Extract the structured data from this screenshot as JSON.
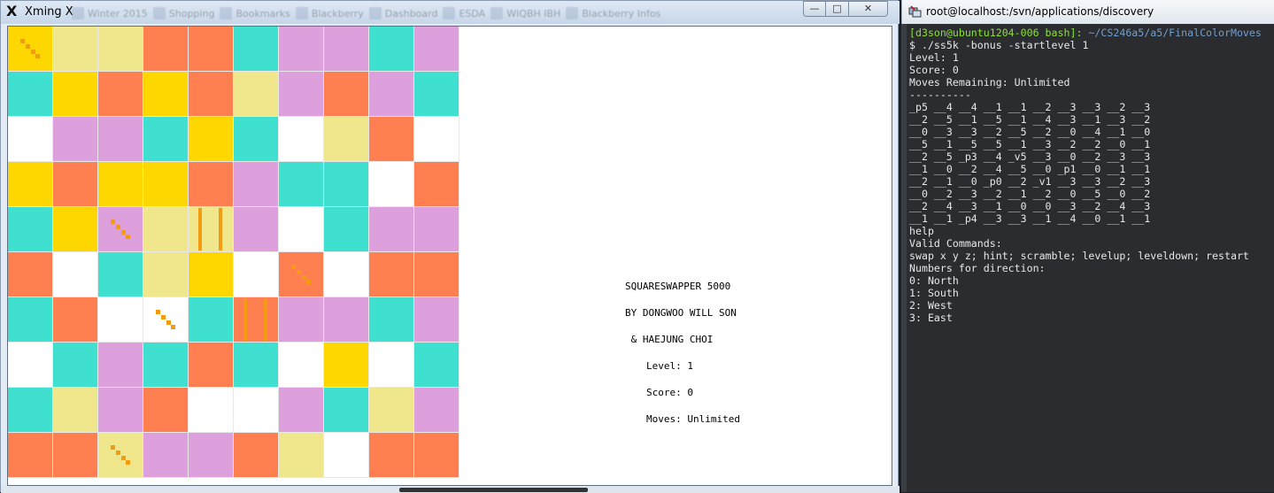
{
  "xming": {
    "title": "Xming X",
    "background_tabs": [
      "Winter 2015",
      "Shopping",
      "Bookmarks",
      "Blackberry",
      "Dashboard",
      "ESDA",
      "WIQBH IBH",
      "Blackberry Infos"
    ],
    "min_label": "—",
    "max_label": "□",
    "close_label": "✕",
    "board": {
      "colors": {
        "Y": "#FFD700",
        "K": "#F0E68C",
        "O": "#FF7F50",
        "T": "#40E0D0",
        "P": "#DDA0DD",
        "W": "#FFFFFF"
      },
      "rows": [
        [
          "Y",
          "K",
          "K",
          "O",
          "O",
          "T",
          "P",
          "P",
          "T",
          "P"
        ],
        [
          "T",
          "Y",
          "O",
          "Y",
          "O",
          "K",
          "P",
          "O",
          "P",
          "T"
        ],
        [
          "W",
          "P",
          "P",
          "T",
          "Y",
          "T",
          "W",
          "K",
          "O",
          "W"
        ],
        [
          "Y",
          "O",
          "Y",
          "Y",
          "O",
          "P",
          "T",
          "T",
          "W",
          "O"
        ],
        [
          "T",
          "Y",
          "P",
          "K",
          "K",
          "P",
          "W",
          "T",
          "P",
          "P"
        ],
        [
          "O",
          "W",
          "T",
          "K",
          "Y",
          "W",
          "O",
          "W",
          "O",
          "O"
        ],
        [
          "T",
          "O",
          "W",
          "W",
          "T",
          "O",
          "P",
          "P",
          "T",
          "P"
        ],
        [
          "W",
          "T",
          "P",
          "T",
          "O",
          "T",
          "W",
          "Y",
          "W",
          "T"
        ],
        [
          "T",
          "K",
          "P",
          "O",
          "W",
          "W",
          "P",
          "T",
          "K",
          "P"
        ],
        [
          "O",
          "O",
          "K",
          "P",
          "P",
          "O",
          "K",
          "W",
          "O",
          "O"
        ]
      ],
      "marks": [
        {
          "row": 0,
          "col": 0,
          "kind": "diag"
        },
        {
          "row": 4,
          "col": 2,
          "kind": "diag"
        },
        {
          "row": 4,
          "col": 4,
          "kind": "bars"
        },
        {
          "row": 5,
          "col": 6,
          "kind": "diag"
        },
        {
          "row": 6,
          "col": 3,
          "kind": "diag"
        },
        {
          "row": 6,
          "col": 5,
          "kind": "bars"
        },
        {
          "row": 9,
          "col": 2,
          "kind": "diag"
        }
      ]
    },
    "info": {
      "title": "SQUARESWAPPER 5000",
      "byline": "BY DONGWOO WILL SON",
      "coauthor": " & HAEJUNG CHOI",
      "level": "Level: 1",
      "score": "Score: 0",
      "moves": "Moves: Unlimited"
    }
  },
  "putty": {
    "title": "root@localhost:/svn/applications/discovery",
    "prompt_user": "[d3son@ubuntu1204-006 bash]:",
    "prompt_path": " ~/CS246a5/a5/FinalColorMoves",
    "output": "$ ./ss5k -bonus -startlevel 1\nLevel: 1\nScore: 0\nMoves Remaining: Unlimited\n----------\n_p5 __4 __4 __1 __1 __2 __3 __3 __2 __3\n__2 __5 __1 __5 __1 __4 __3 __1 __3 __2\n__0 __3 __3 __2 __5 __2 __0 __4 __1 __0\n__5 __1 __5 __5 __1 __3 __2 __2 __0 __1\n__2 __5 _p3 __4 _v5 __3 __0 __2 __3 __3\n__1 __0 __2 __4 __5 __0 _p1 __0 __1 __1\n__2 __1 __0 _p0 __2 _v1 __3 __3 __2 __3\n__0 __2 __3 __2 __1 __2 __0 __5 __0 __2\n__2 __4 __3 __1 __0 __0 __3 __2 __4 __3\n__1 __1 _p4 __3 __3 __1 __4 __0 __1 __1\nhelp\nValid Commands:\nswap x y z; hint; scramble; levelup; leveldown; restart\nNumbers for direction:\n0: North\n1: South\n2: West\n3: East"
  }
}
